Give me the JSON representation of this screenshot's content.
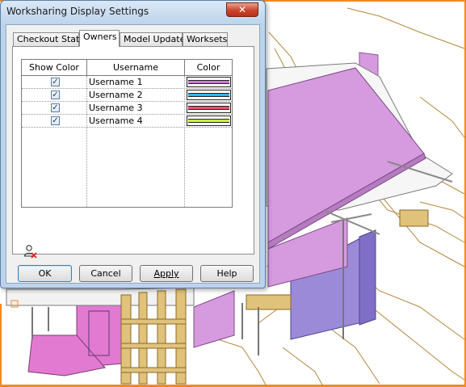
{
  "window": {
    "title": "Worksharing Display Settings",
    "close_glyph": "✕"
  },
  "tabs": [
    {
      "label": "Checkout Status"
    },
    {
      "label": "Owners"
    },
    {
      "label": "Model Updates"
    },
    {
      "label": "Worksets"
    }
  ],
  "active_tab": "Owners",
  "grid": {
    "columns": [
      "Show Color",
      "Username",
      "Color"
    ],
    "rows": [
      {
        "show": true,
        "username": "Username 1",
        "color": "#c87ad6"
      },
      {
        "show": true,
        "username": "Username 2",
        "color": "#29b8ee"
      },
      {
        "show": true,
        "username": "Username 3",
        "color": "#f0506e"
      },
      {
        "show": true,
        "username": "Username 4",
        "color": "#c8f03a"
      }
    ]
  },
  "icons": {
    "remove_user": "user-remove-icon",
    "checkbox_checked": "✓"
  },
  "buttons": {
    "ok": "OK",
    "cancel": "Cancel",
    "apply": "Apply",
    "help": "Help"
  },
  "colors": {
    "building_magenta": "#d69ade",
    "building_lavender": "#9a8ad8",
    "wood": "#e0c27a",
    "contour": "#b5873e",
    "orange_frame": "#f08a24"
  }
}
